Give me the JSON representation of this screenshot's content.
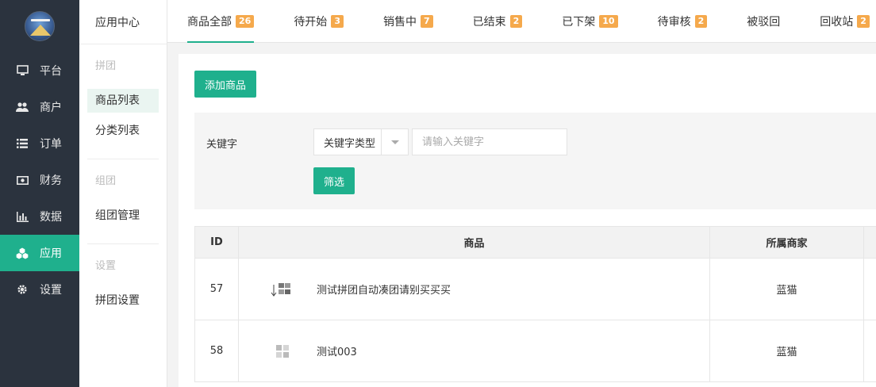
{
  "nav": {
    "items": [
      {
        "label": "平台",
        "icon": "monitor-icon"
      },
      {
        "label": "商户",
        "icon": "users-icon"
      },
      {
        "label": "订单",
        "icon": "list-icon"
      },
      {
        "label": "财务",
        "icon": "money-icon"
      },
      {
        "label": "数据",
        "icon": "bar-chart-icon"
      },
      {
        "label": "应用",
        "icon": "cubes-icon"
      },
      {
        "label": "设置",
        "icon": "gear-icon"
      }
    ],
    "active_index": 5
  },
  "subnav": {
    "title": "应用中心",
    "groups": [
      {
        "title": "拼团",
        "items": [
          "商品列表",
          "分类列表"
        ]
      },
      {
        "title": "组团",
        "items": [
          "组团管理"
        ]
      },
      {
        "title": "设置",
        "items": [
          "拼团设置"
        ]
      }
    ]
  },
  "tabs": [
    {
      "label": "商品全部",
      "count": "26"
    },
    {
      "label": "待开始",
      "count": "3"
    },
    {
      "label": "销售中",
      "count": "7"
    },
    {
      "label": "已结束",
      "count": "2"
    },
    {
      "label": "已下架",
      "count": "10"
    },
    {
      "label": "待审核",
      "count": "2"
    },
    {
      "label": "被驳回",
      "count": ""
    },
    {
      "label": "回收站",
      "count": "2"
    }
  ],
  "content": {
    "add_button": "添加商品",
    "filter": {
      "keyword_label": "关键字",
      "type_select": "关键字类型",
      "keyword_placeholder": "请输入关键字",
      "filter_button": "筛选"
    },
    "table": {
      "headers": [
        "ID",
        "商品",
        "所属商家"
      ],
      "rows": [
        {
          "id": "57",
          "name": "测试拼团自动凑团请别买买买",
          "merchant": "蓝猫"
        },
        {
          "id": "58",
          "name": "测试003",
          "merchant": "蓝猫"
        }
      ]
    }
  },
  "colors": {
    "accent": "#1fb08d",
    "nav_bg": "#2b333e",
    "badge": "#f5a94c"
  }
}
